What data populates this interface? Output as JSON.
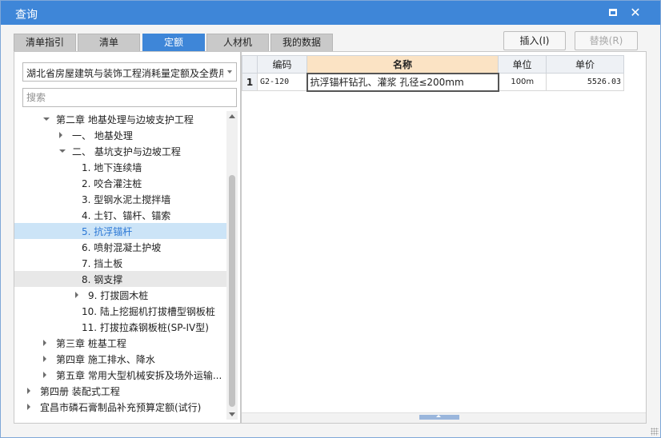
{
  "window": {
    "title": "查询"
  },
  "tabs": [
    {
      "label": "清单指引"
    },
    {
      "label": "清单"
    },
    {
      "label": "定额"
    },
    {
      "label": "人材机"
    },
    {
      "label": "我的数据"
    }
  ],
  "toolbar": {
    "insert_label": "插入(I)",
    "replace_label": "替换(R)"
  },
  "left": {
    "combo_value": "湖北省房屋建筑与装饰工程消耗量定额及全费用基价表",
    "search_placeholder": "搜索",
    "tree": [
      {
        "label": "第二章 地基处理与边坡支护工程",
        "twisty": "open"
      },
      {
        "label": "一、 地基处理",
        "twisty": "closed"
      },
      {
        "label": "二、 基坑支护与边坡工程",
        "twisty": "open"
      },
      {
        "label": "1. 地下连续墙",
        "twisty": "none"
      },
      {
        "label": "2. 咬合灌注桩",
        "twisty": "none"
      },
      {
        "label": "3. 型钢水泥土搅拌墙",
        "twisty": "none"
      },
      {
        "label": "4. 土钉、锚杆、锚索",
        "twisty": "none"
      },
      {
        "label": "5. 抗浮锚杆",
        "twisty": "none",
        "state": "selected"
      },
      {
        "label": "6. 喷射混凝土护坡",
        "twisty": "none"
      },
      {
        "label": "7. 挡土板",
        "twisty": "none"
      },
      {
        "label": "8. 钢支撑",
        "twisty": "none",
        "state": "hover"
      },
      {
        "label": "9. 打拔圆木桩",
        "twisty": "closed"
      },
      {
        "label": "10. 陆上挖掘机打拔槽型钢板桩",
        "twisty": "none"
      },
      {
        "label": "11. 打拔拉森钢板桩(SP-IV型)",
        "twisty": "none"
      },
      {
        "label": "第三章 桩基工程",
        "twisty": "closed"
      },
      {
        "label": "第四章 施工排水、降水",
        "twisty": "closed"
      },
      {
        "label": "第五章 常用大型机械安拆及场外运输...",
        "twisty": "closed"
      },
      {
        "label": "第四册 装配式工程",
        "twisty": "closed"
      },
      {
        "label": "宜昌市磷石膏制品补充预算定额(试行)",
        "twisty": "closed"
      }
    ]
  },
  "grid": {
    "columns": [
      "编码",
      "名称",
      "单位",
      "单价"
    ],
    "rows": [
      {
        "num": "1",
        "code": "G2-120",
        "name": "抗浮锚杆钻孔、灌浆 孔径≤200mm",
        "unit": "100m",
        "price": "5526.03"
      }
    ]
  }
}
